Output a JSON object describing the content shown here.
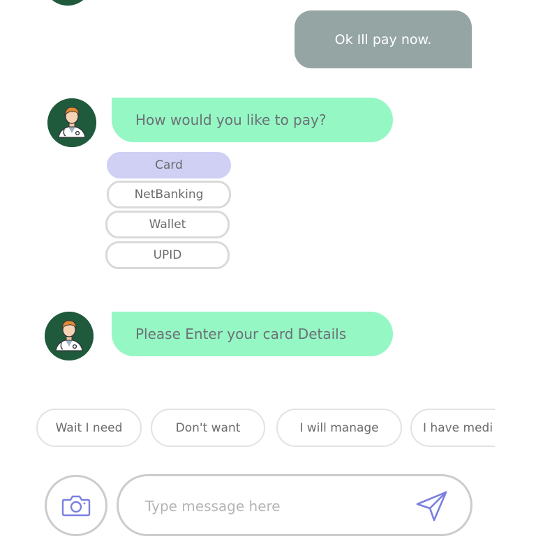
{
  "messages": {
    "user_reply": "Ok Ill pay now.",
    "bot_question": "How would you like to pay?",
    "bot_card_prompt": "Please Enter your card Details"
  },
  "payment_options": [
    {
      "label": "Card",
      "selected": true
    },
    {
      "label": "NetBanking",
      "selected": false
    },
    {
      "label": "Wallet",
      "selected": false
    },
    {
      "label": "UPID",
      "selected": false
    }
  ],
  "suggestions": [
    "Wait I need",
    "Don't want",
    "I will manage",
    "I have medi"
  ],
  "composer": {
    "placeholder": "Type message here",
    "camera_icon": "camera-icon",
    "send_icon": "send-icon"
  },
  "colors": {
    "user_bubble": "#95a5a3",
    "bot_bubble": "#95f7c4",
    "selected_option": "#cfd0f4",
    "avatar_bg": "#1f5a3c",
    "send_icon": "#7a7fe0"
  }
}
